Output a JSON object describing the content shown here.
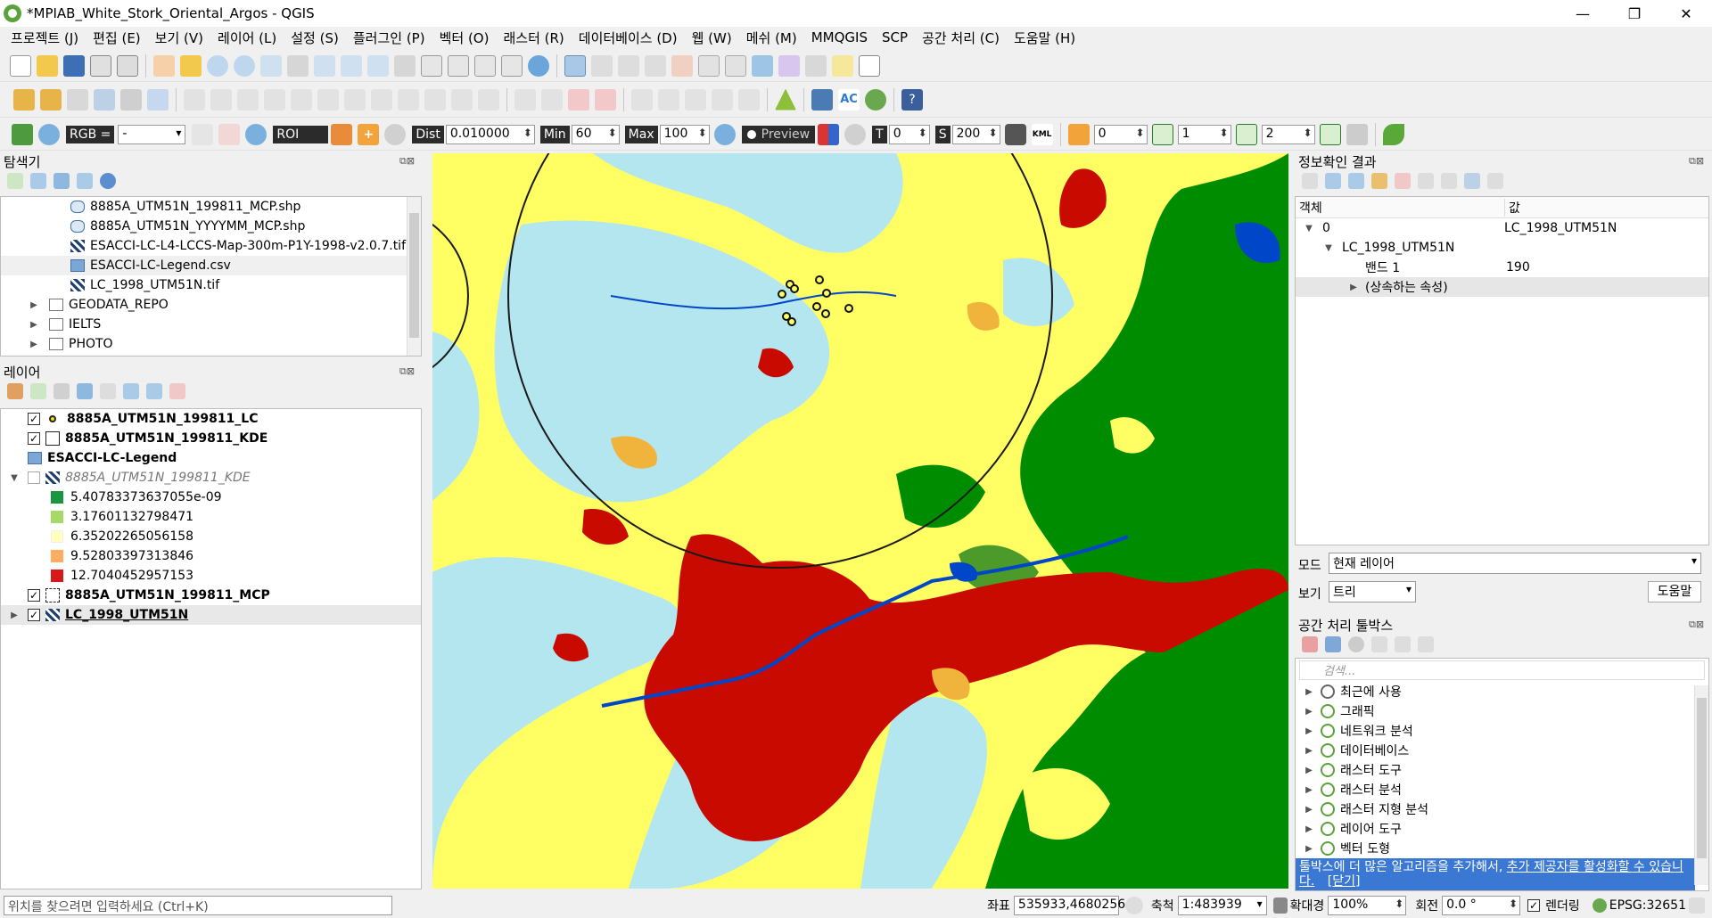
{
  "window": {
    "title": "*MPIAB_White_Stork_Oriental_Argos - QGIS",
    "controls": [
      "—",
      "❐",
      "✕"
    ]
  },
  "menu": [
    "프로젝트 (J)",
    "편집 (E)",
    "보기 (V)",
    "레이어 (L)",
    "설정 (S)",
    "플러그인 (P)",
    "벡터 (O)",
    "래스터 (R)",
    "데이터베이스 (D)",
    "웹 (W)",
    "메쉬 (M)",
    "MMQGIS",
    "SCP",
    "공간 처리 (C)",
    "도움말 (H)"
  ],
  "scp_toolbar": {
    "rgb_label": "RGB =",
    "rgb_value": "-",
    "roi_label": "ROI",
    "dist_label": "Dist",
    "dist_value": "0.010000",
    "min_label": "Min",
    "min_value": "60",
    "max_label": "Max",
    "max_value": "100",
    "preview_label": "Preview",
    "t_label": "T",
    "t_value": "0",
    "s_label": "S",
    "s_value": "200",
    "kml_label": "KML",
    "spin1": "0",
    "spin2": "1",
    "spin3": "2"
  },
  "browser": {
    "title": "탐색기",
    "items": [
      {
        "label": "8885A_UTM51N_199811_MCP.shp",
        "icon": "polygon-file-icon"
      },
      {
        "label": "8885A_UTM51N_YYYYMM_MCP.shp",
        "icon": "polygon-file-icon"
      },
      {
        "label": "ESACCI-LC-L4-LCCS-Map-300m-P1Y-1998-v2.0.7.tif",
        "icon": "raster-file-icon"
      },
      {
        "label": "ESACCI-LC-Legend.csv",
        "icon": "table-file-icon"
      },
      {
        "label": "LC_1998_UTM51N.tif",
        "icon": "raster-file-icon"
      },
      {
        "label": "GEODATA_REPO",
        "icon": "folder-icon"
      },
      {
        "label": "IELTS",
        "icon": "folder-icon"
      },
      {
        "label": "PHOTO",
        "icon": "folder-icon"
      }
    ]
  },
  "layers": {
    "title": "레이어",
    "items": [
      {
        "label": "8885A_UTM51N_199811_LC",
        "checked": "✓"
      },
      {
        "label": "8885A_UTM51N_199811_KDE",
        "checked": "✓"
      },
      {
        "label": "ESACCI-LC-Legend"
      },
      {
        "label": "8885A_UTM51N_199811_KDE",
        "checked": ""
      },
      {
        "label": "8885A_UTM51N_199811_MCP",
        "checked": "✓"
      },
      {
        "label": "LC_1998_UTM51N",
        "checked": "✓"
      }
    ],
    "kde_legend": [
      {
        "value": "5.40783373637055e-09",
        "color": "#1a9641"
      },
      {
        "value": "3.17601132798471",
        "color": "#a6d96a"
      },
      {
        "value": "6.35202265056158",
        "color": "#ffffc0"
      },
      {
        "value": "9.52803397313846",
        "color": "#fdae61"
      },
      {
        "value": "12.7040452957153",
        "color": "#d7191c"
      }
    ]
  },
  "identify": {
    "title": "정보확인 결과",
    "col_feature": "객체",
    "col_value": "값",
    "row0_label": "0",
    "row0_value": "LC_1998_UTM51N",
    "row1_label": "LC_1998_UTM51N",
    "row2_label": "밴드 1",
    "row2_value": "190",
    "row3_label": "(상속하는 속성)",
    "mode_label": "모드",
    "mode_value": "현재 레이어",
    "view_label": "보기",
    "view_value": "트리",
    "help_button": "도움말"
  },
  "toolbox": {
    "title": "공간 처리 툴박스",
    "search_placeholder": "검색...",
    "items": [
      "최근에 사용",
      "그래픽",
      "네트워크 분석",
      "데이터베이스",
      "래스터 도구",
      "래스터 분석",
      "래스터 지형 분석",
      "레이어 도구",
      "벡터 도형"
    ],
    "notice_text": "툴박스에 더 많은 알고리즘을 추가해서, ",
    "notice_link": "추가 제공자를 활성화할 수 있습니다.",
    "notice_close": "[닫기]"
  },
  "statusbar": {
    "locator_placeholder": "위치를 찾으려면 입력하세요 (Ctrl+K)",
    "coord_label": "좌표",
    "coord_value": "535933,4680256",
    "scale_label": "축척",
    "scale_value": "1:483939",
    "magnifier_label": "확대경",
    "magnifier_value": "100%",
    "rotation_label": "회전",
    "rotation_value": "0.0 °",
    "render_label": "렌더링",
    "crs_label": "EPSG:32651"
  },
  "colors": {
    "urban": "#c80a00",
    "forest": "#008c00",
    "cropland": "#ffff64",
    "grassland": "#b4e6f0",
    "mosaic": "#f0b43c",
    "water": "#0046c8",
    "tree_mix": "#4c9a2a",
    "kde_circle": "#1a1a1a"
  }
}
